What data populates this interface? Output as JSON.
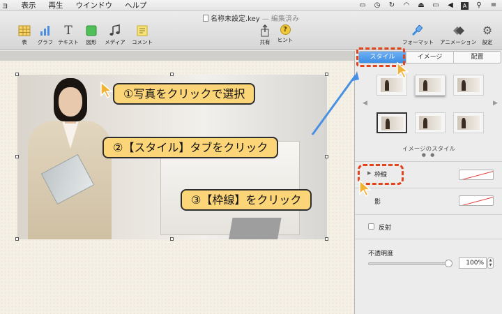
{
  "menubar": {
    "items": [
      "ョ",
      "表示",
      "再生",
      "ウインドウ",
      "ヘルプ"
    ],
    "status_icons": [
      "airplay-icon",
      "time-machine-icon",
      "sync-icon",
      "wifi-icon",
      "eject-icon",
      "battery-icon",
      "volume-icon",
      "input-source-icon",
      "search-icon",
      "list-icon"
    ]
  },
  "window": {
    "title": "名称未設定.key",
    "state": "— 編集済み"
  },
  "toolbar": {
    "table": "表",
    "chart": "グラフ",
    "text": "テキスト",
    "shape": "図形",
    "media": "メディア",
    "comment": "コメント",
    "share": "共有",
    "hint": "ヒント",
    "format": "フォーマット",
    "animate": "アニメーション",
    "settings": "設定",
    "text_glyph": "T",
    "hint_glyph": "?"
  },
  "inspector": {
    "tabs": [
      "スタイル",
      "イメージ",
      "配置"
    ],
    "active_tab": 0,
    "image_style_label": "イメージのスタイル",
    "page_dots": "● ●",
    "border_label": "枠線",
    "shadow_label": "影",
    "reflection_label": "反射",
    "opacity_label": "不透明度",
    "opacity_value": "100%",
    "opacity_fraction": 1.0,
    "arrow_left": "◀",
    "arrow_right": "▶",
    "disclosure": "▶",
    "stepper": "▲\n▼"
  },
  "annotations": {
    "step1": "①写真をクリックで選択",
    "step2": "②【スタイル】タブをクリック",
    "step3": "③【枠線】をクリック",
    "highlight_color": "#e2441e",
    "callout_color": "#fbd577"
  },
  "colors": {
    "accent": "#3d8ee6"
  }
}
